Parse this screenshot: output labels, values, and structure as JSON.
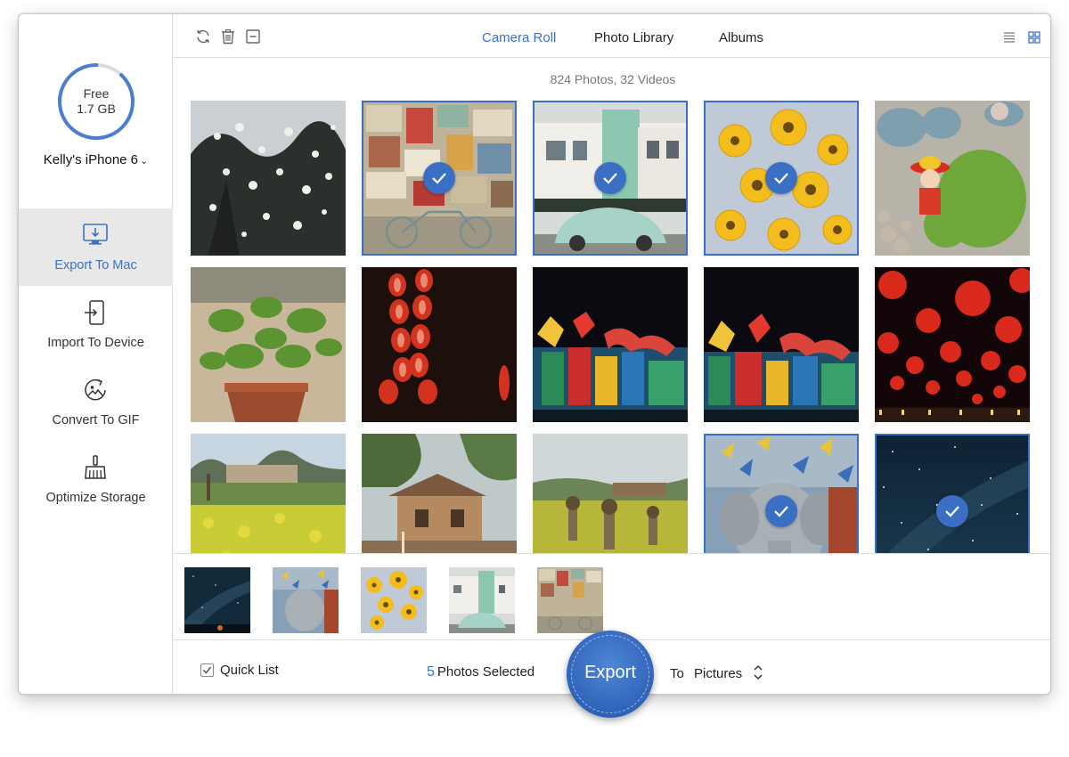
{
  "window": {
    "controls": [
      "close",
      "minimize"
    ]
  },
  "sidebar": {
    "storage": {
      "label": "Free",
      "value": "1.7 GB",
      "used_fraction": 0.88,
      "ring_color": "#4a7fd0"
    },
    "device": {
      "name": "Kelly's iPhone 6",
      "dropdown_icon": "chevron-down-icon"
    },
    "nav": [
      {
        "label": "Export To Mac",
        "icon": "monitor-export-icon",
        "active": true
      },
      {
        "label": "Import To Device",
        "icon": "device-import-icon",
        "active": false
      },
      {
        "label": "Convert To GIF",
        "icon": "gif-convert-icon",
        "active": false
      },
      {
        "label": "Optimize Storage",
        "icon": "broom-icon",
        "active": false
      }
    ]
  },
  "toolbar": {
    "icons": [
      "refresh-icon",
      "trash-icon",
      "minus-box-icon"
    ],
    "tabs": [
      {
        "label": "Camera Roll",
        "active": true
      },
      {
        "label": "Photo Library",
        "active": false
      },
      {
        "label": "Albums",
        "active": false
      }
    ],
    "view_icons": [
      "list-view-icon",
      "grid-view-icon"
    ],
    "accent": "#3b73c2"
  },
  "grid": {
    "summary": "824 Photos, 32 Videos",
    "photos": [
      {
        "subject": "white-flowers-tree",
        "selected": false
      },
      {
        "subject": "poster-wall-bicycle",
        "selected": true
      },
      {
        "subject": "green-building-beetle-car",
        "selected": true
      },
      {
        "subject": "yellow-daisies",
        "selected": true
      },
      {
        "subject": "succulents-figurine",
        "selected": false
      },
      {
        "subject": "potted-mint-plant",
        "selected": false
      },
      {
        "subject": "red-lanterns-column",
        "selected": false
      },
      {
        "subject": "lantern-festival-dragon",
        "selected": false
      },
      {
        "subject": "lantern-festival-dragon-2",
        "selected": false
      },
      {
        "subject": "red-lanterns-night",
        "selected": false
      },
      {
        "subject": "rapeseed-field-village",
        "selected": false
      },
      {
        "subject": "village-houses-trees",
        "selected": false
      },
      {
        "subject": "garden-scarecrows",
        "selected": false
      },
      {
        "subject": "elephant-pinwheels",
        "selected": true
      },
      {
        "subject": "milky-way-night-sky",
        "selected": true
      }
    ]
  },
  "quick_list": {
    "label": "Quick List",
    "checked": true,
    "items": [
      "milky-way-night-sky",
      "elephant-pinwheels",
      "yellow-daisies",
      "green-building-beetle-car",
      "poster-wall-bicycle"
    ]
  },
  "footer": {
    "selected_count": "5",
    "selected_label": "Photos Selected",
    "export_label": "Export",
    "to_label": "To",
    "destination": "Pictures"
  }
}
